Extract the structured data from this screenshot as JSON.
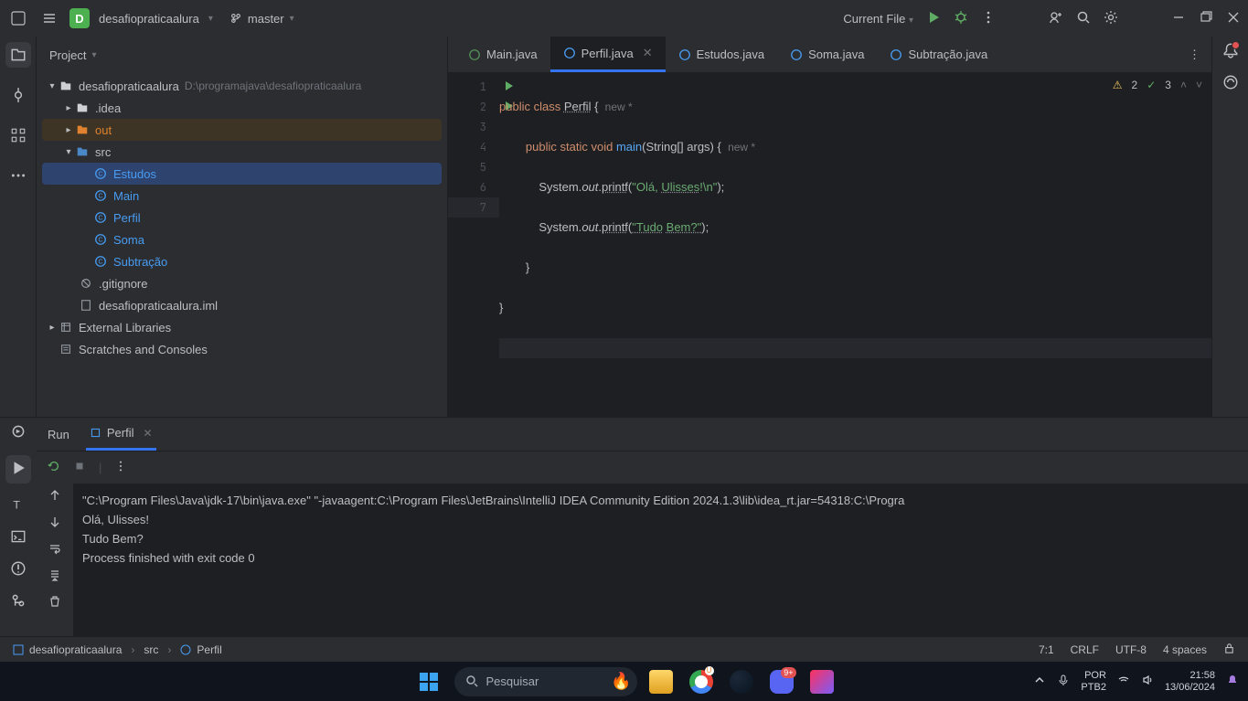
{
  "titlebar": {
    "project_initial": "D",
    "project_name": "desafiopraticaalura",
    "branch": "master",
    "run_config": "Current File"
  },
  "project_panel": {
    "title": "Project",
    "root": "desafiopraticaalura",
    "root_path": "D:\\programajava\\desafiopraticaalura",
    "idea": ".idea",
    "out": "out",
    "src": "src",
    "files": {
      "estudos": "Estudos",
      "main": "Main",
      "perfil": "Perfil",
      "soma": "Soma",
      "subtracao": "Subtração"
    },
    "gitignore": ".gitignore",
    "iml": "desafiopraticaalura.iml",
    "ext_lib": "External Libraries",
    "scratches": "Scratches and Consoles"
  },
  "tabs": {
    "main": "Main.java",
    "perfil": "Perfil.java",
    "estudos": "Estudos.java",
    "soma": "Soma.java",
    "subtracao": "Subtração.java"
  },
  "editor": {
    "warn_count": "2",
    "ok_count": "3",
    "inlay_new": "new *",
    "lines": {
      "l1a": "public",
      "l1b": "class",
      "l1c": "Perfil",
      "l1d": "{",
      "l2a": "public",
      "l2b": "static",
      "l2c": "void",
      "l2d": "main",
      "l2e": "(String[] args) {",
      "l3a": "System.",
      "l3b": "out",
      "l3c": ".",
      "l3d": "printf",
      "l3e": "(",
      "l3f": "\"Olá, ",
      "l3g": "Ulisses",
      "l3h": "!\\n\"",
      "l3i": ");",
      "l4a": "System.",
      "l4b": "out",
      "l4c": ".",
      "l4d": "printf",
      "l4e": "(",
      "l4f": "\"Tudo",
      "l4g": " ",
      "l4h": "Bem?\"",
      "l4i": ");",
      "l5": "}",
      "l6": "}"
    }
  },
  "run": {
    "tab1": "Run",
    "tab2": "Perfil",
    "output_cmd": "\"C:\\Program Files\\Java\\jdk-17\\bin\\java.exe\" \"-javaagent:C:\\Program Files\\JetBrains\\IntelliJ IDEA Community Edition 2024.1.3\\lib\\idea_rt.jar=54318:C:\\Progra",
    "out1": "Olá, Ulisses!",
    "out2": "Tudo Bem?",
    "out3": "Process finished with exit code 0"
  },
  "footer": {
    "bc1": "desafiopraticaalura",
    "bc2": "src",
    "bc3": "Perfil",
    "pos": "7:1",
    "eol": "CRLF",
    "enc": "UTF-8",
    "indent": "4 spaces"
  },
  "taskbar": {
    "search_placeholder": "Pesquisar",
    "lang1": "POR",
    "lang2": "PTB2",
    "time": "21:58",
    "date": "13/06/2024",
    "discord_badge": "9+"
  }
}
